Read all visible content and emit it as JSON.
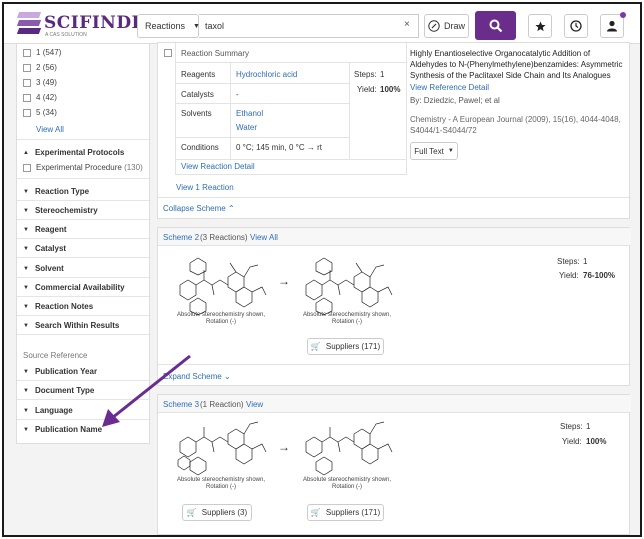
{
  "header": {
    "logo_text": "SCIFINDER",
    "logo_sup": "n",
    "logo_sub": "A CAS SOLUTION",
    "search_type": "Reactions",
    "search_value": "taxol",
    "clear": "×",
    "draw_label": "Draw"
  },
  "sidebar": {
    "steps": [
      {
        "label": "1",
        "count": "(547)"
      },
      {
        "label": "2",
        "count": "(56)"
      },
      {
        "label": "3",
        "count": "(49)"
      },
      {
        "label": "4",
        "count": "(42)"
      },
      {
        "label": "5",
        "count": "(34)"
      }
    ],
    "view_all": "View All",
    "experimental_protocols": "Experimental Protocols",
    "experimental_procedure": "Experimental Procedure",
    "experimental_procedure_count": "(130)",
    "filters": [
      "Reaction Type",
      "Stereochemistry",
      "Reagent",
      "Catalyst",
      "Solvent",
      "Commercial Availability",
      "Reaction Notes",
      "Search Within Results"
    ],
    "source_reference": "Source Reference",
    "source_filters": [
      "Publication Year",
      "Document Type",
      "Language",
      "Publication Name"
    ]
  },
  "scheme1": {
    "summary_title": "Reaction Summary",
    "rows": [
      {
        "label": "Reagents",
        "value": "Hydrochloric acid"
      },
      {
        "label": "Catalysts",
        "value": "-"
      },
      {
        "label": "Solvents",
        "value": "Ethanol",
        "value2": "Water"
      },
      {
        "label": "Conditions",
        "value": "0 °C; 145 min, 0 °C → rt"
      }
    ],
    "steps_label": "Steps:",
    "steps_value": "1",
    "yield_label": "Yield:",
    "yield_value": "100%",
    "view_reaction_detail": "View Reaction Detail",
    "ref_title_1": "Highly Enantioselective Organocatalytic Addition of",
    "ref_title_2": "Aldehydes to N-(Phenylmethylene)benzamides: Asymmetric",
    "ref_title_3": "Synthesis of the Paclitaxel Side Chain and Its Analogues",
    "view_reference_detail": "View Reference Detail",
    "authors": "By: Dziedzic, Pawel; et al",
    "citation_1": "Chemistry - A European Journal (2009), 15(16), 4044-4048,",
    "citation_2": "S4044/1-S4044/72",
    "full_text": "Full Text",
    "view_reactions": "View 1 Reaction",
    "collapse": "Collapse Scheme"
  },
  "scheme2": {
    "title": "Scheme 2",
    "count": "(3 Reactions)",
    "view_all": "View All",
    "steps_label": "Steps:",
    "steps_value": "1",
    "yield_label": "Yield:",
    "yield_value": "76-100%",
    "caption_1": "Absolute stereochemistry shown,",
    "caption_2": "Rotation (-)",
    "suppliers": "Suppliers (171)",
    "expand": "Expand Scheme"
  },
  "scheme3": {
    "title": "Scheme 3",
    "count": "(1 Reaction)",
    "view": "View",
    "steps_label": "Steps:",
    "steps_value": "1",
    "yield_label": "Yield:",
    "yield_value": "100%",
    "caption_1": "Absolute stereochemistry shown,",
    "caption_2": "Rotation (-)",
    "suppliers_left": "Suppliers (3)",
    "suppliers_right": "Suppliers (171)"
  },
  "colors": {
    "brand": "#6b2d8c",
    "link": "#2e6db4",
    "callout": "#6a2c91"
  }
}
